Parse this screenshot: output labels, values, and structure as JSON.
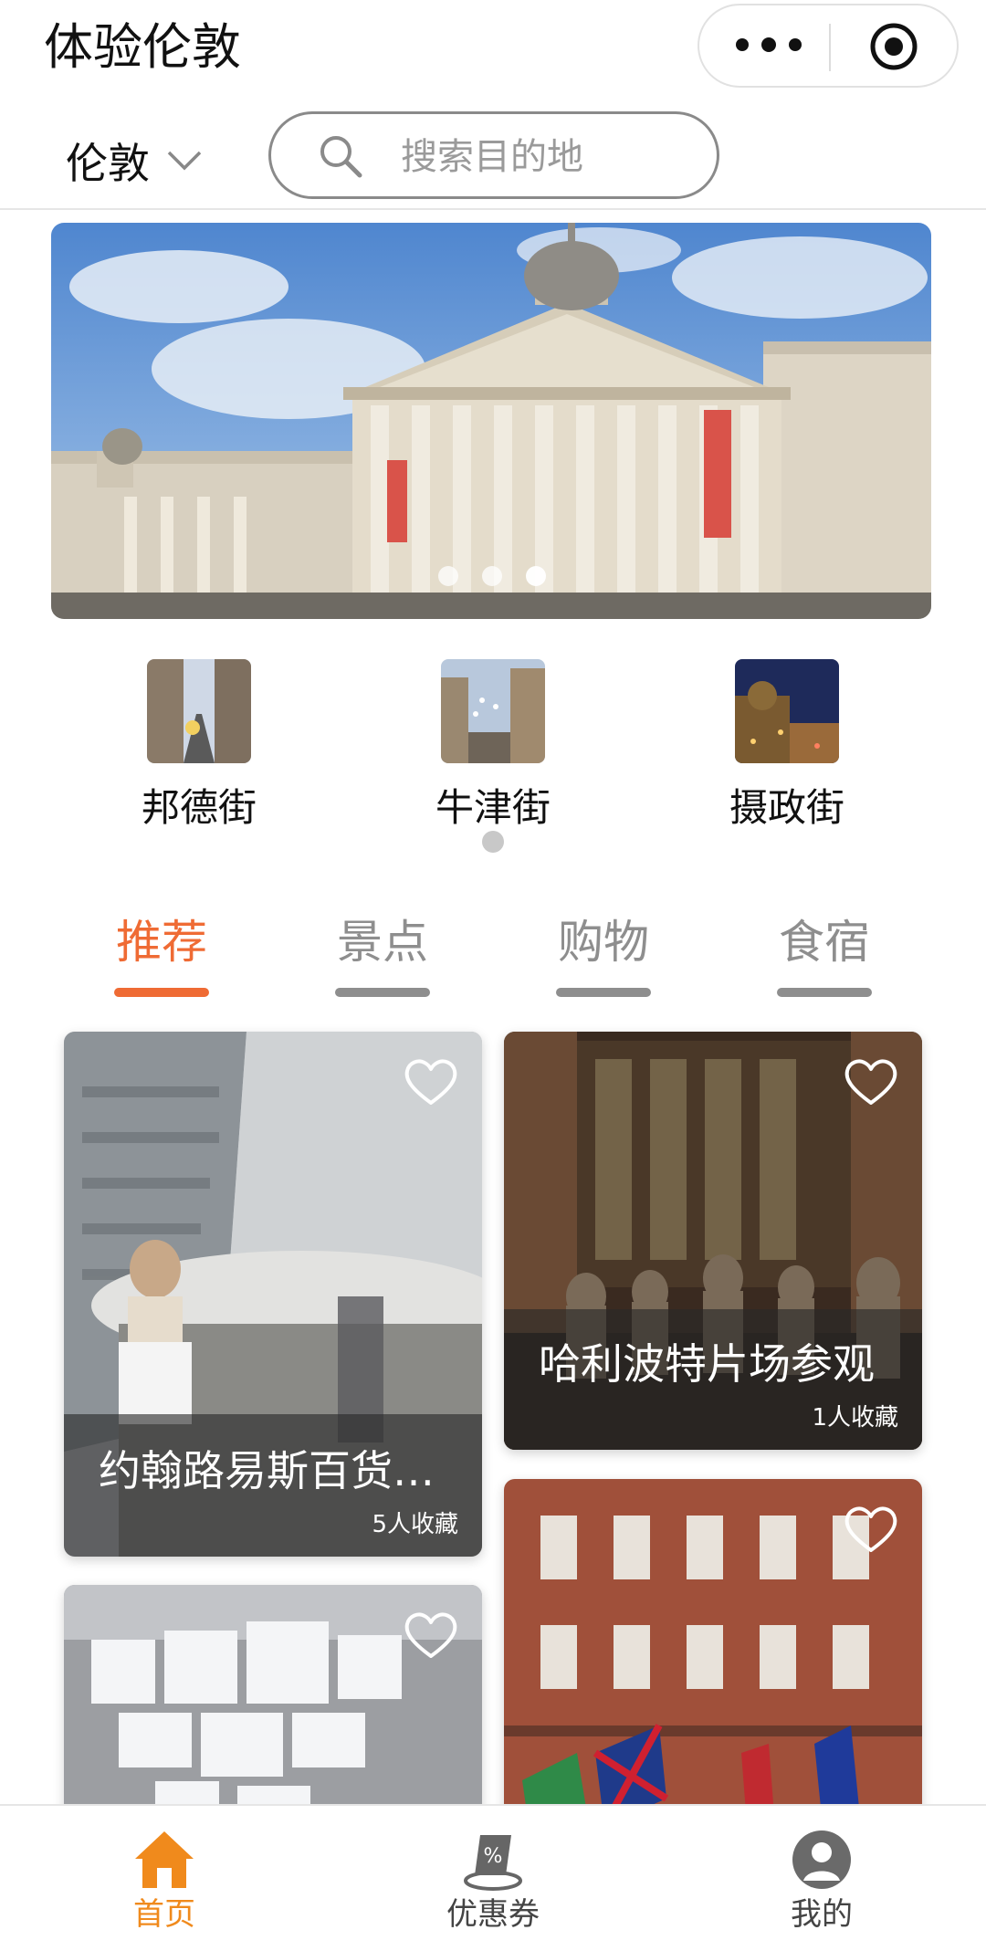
{
  "title_bar": {
    "title": "体验伦敦",
    "more_icon": "more-dots-icon",
    "close_icon": "miniprogram-close-icon"
  },
  "search_row": {
    "city": "伦敦",
    "city_icon": "chevron-down-icon",
    "search_placeholder": "搜索目的地",
    "search_icon": "search-icon"
  },
  "banner": {
    "image": "national-gallery-photo",
    "slide_count": 3,
    "active_slide": 3
  },
  "quick_links": [
    {
      "label": "邦德街",
      "image": "bond-street-photo"
    },
    {
      "label": "牛津街",
      "image": "oxford-street-photo"
    },
    {
      "label": "摄政街",
      "image": "regent-street-photo"
    }
  ],
  "tabs": [
    {
      "label": "推荐",
      "active": true
    },
    {
      "label": "景点",
      "active": false
    },
    {
      "label": "购物",
      "active": false
    },
    {
      "label": "食宿",
      "active": false
    }
  ],
  "cards": [
    {
      "title": "约翰路易斯百货…",
      "favorites": "5人收藏",
      "image": "john-lewis-store-photo",
      "icon": "heart-outline-icon"
    },
    {
      "title": "哈利波特片场参观",
      "favorites": "1人收藏",
      "image": "harry-potter-studio-photo",
      "icon": "heart-outline-icon"
    },
    {
      "title": "",
      "favorites": "",
      "image": "chandelier-interior-photo",
      "icon": "heart-outline-icon"
    },
    {
      "title": "",
      "favorites": "",
      "image": "hotel-flags-photo",
      "icon": "heart-outline-icon"
    }
  ],
  "bottom_nav": [
    {
      "label": "首页",
      "icon": "home-icon",
      "active": true
    },
    {
      "label": "优惠券",
      "icon": "coupon-icon",
      "active": false
    },
    {
      "label": "我的",
      "icon": "user-icon",
      "active": false
    }
  ],
  "colors": {
    "accent": "#ef6b34",
    "nav_active": "#f08a1c",
    "tab_inactive": "#8e8e8e"
  }
}
